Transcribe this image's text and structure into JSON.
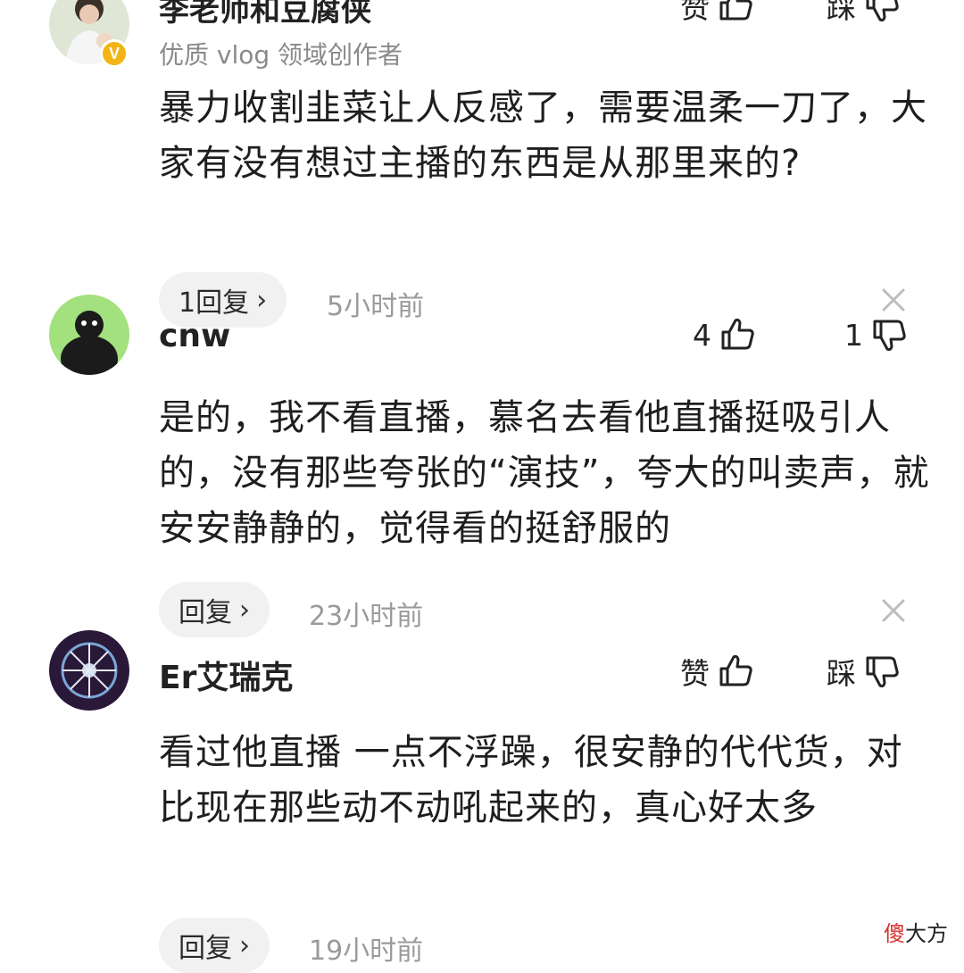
{
  "comments": [
    {
      "username": "李老师和豆腐侠",
      "subtitle": "优质 vlog 领域创作者",
      "verified_badge": "V",
      "like_label": "赞",
      "dislike_label": "踩",
      "text": "暴力收割韭菜让人反感了，需要温柔一刀了，大家有没有想过主播的东西是从那里来的?",
      "reply_label": "1回复",
      "time": "5小时前"
    },
    {
      "username": "cnw",
      "like_label": "4",
      "dislike_label": "1",
      "text": "是的，我不看直播，慕名去看他直播挺吸引人的，没有那些夸张的“演技”，夸大的叫卖声，就安安静静的，觉得看的挺舒服的",
      "reply_label": "回复",
      "time": "23小时前"
    },
    {
      "username": "Er艾瑞克",
      "like_label": "赞",
      "dislike_label": "踩",
      "text": "看过他直播 一点不浮躁，很安静的代代货，对比现在那些动不动吼起来的，真心好太多",
      "reply_label": "回复",
      "time": "19小时前"
    }
  ],
  "icons": {
    "like": "thumbs-up-outline-icon",
    "dislike": "thumbs-down-outline-icon",
    "chevron": "›",
    "close": "close-icon"
  },
  "watermark": {
    "part1": "傻",
    "part2": "大方"
  },
  "colors": {
    "accent_badge": "#f2b515",
    "pill_bg": "#f1f1f1",
    "muted": "#9a9a9a",
    "watermark_red": "#d9302b"
  }
}
